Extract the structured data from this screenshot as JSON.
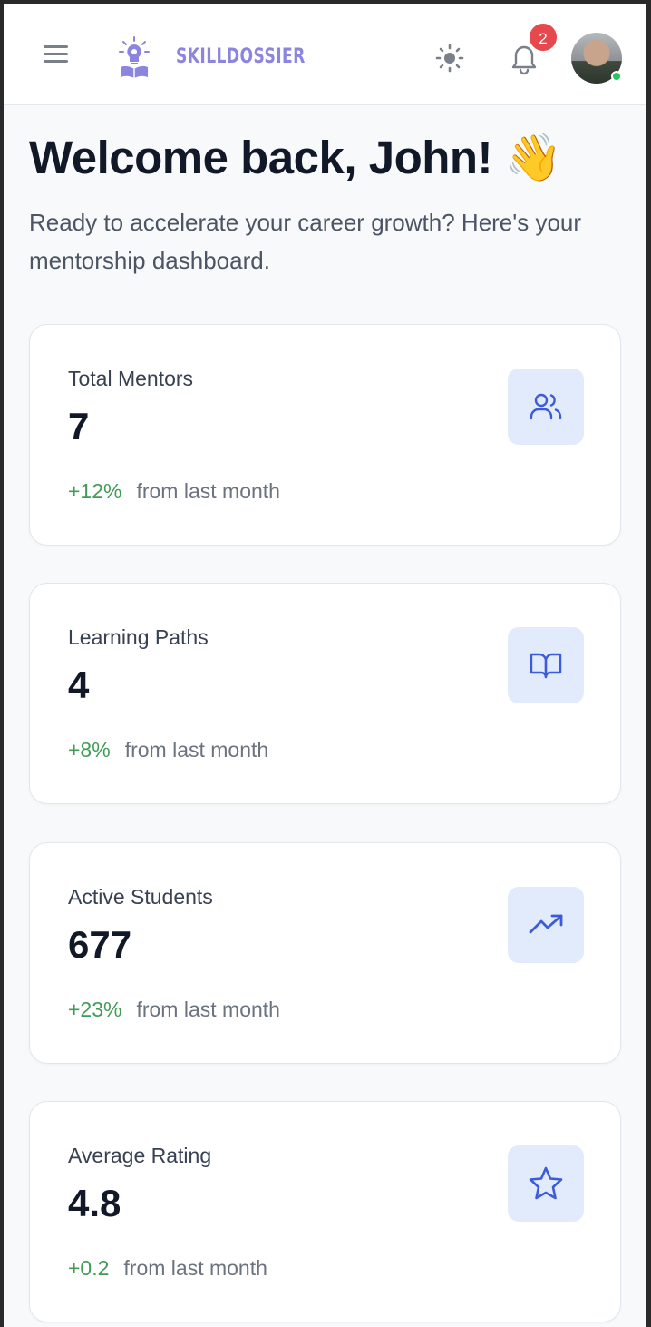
{
  "app": {
    "brand": "SKILLDOSSIER",
    "notification_count": "2"
  },
  "icons": {
    "menu": "hamburger-menu-icon",
    "logo": "lightbulb-book-icon",
    "theme": "sun-icon",
    "notifications": "bell-icon",
    "avatar": "user-avatar"
  },
  "greeting": {
    "title": "Welcome back, John! 👋",
    "subtitle": "Ready to accelerate your career growth? Here's your mentorship dashboard."
  },
  "stats": [
    {
      "label": "Total Mentors",
      "value": "7",
      "change": "+12%",
      "note": "from last month",
      "icon": "users-icon"
    },
    {
      "label": "Learning Paths",
      "value": "4",
      "change": "+8%",
      "note": "from last month",
      "icon": "book-open-icon"
    },
    {
      "label": "Active Students",
      "value": "677",
      "change": "+23%",
      "note": "from last month",
      "icon": "trending-up-icon"
    },
    {
      "label": "Average Rating",
      "value": "4.8",
      "change": "+0.2",
      "note": "from last month",
      "icon": "star-icon"
    }
  ],
  "colors": {
    "accent": "#3b5bdb",
    "brand": "#8b85e0",
    "positive": "#3f9b55",
    "badge": "#e5484d",
    "icon_tile_bg": "#e2ebfb"
  }
}
